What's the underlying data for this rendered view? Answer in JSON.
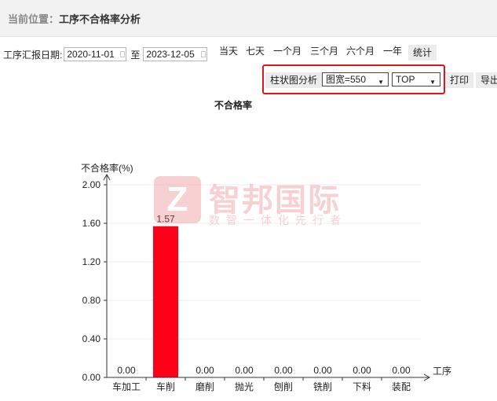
{
  "breadcrumb": {
    "label": "当前位置：",
    "page": "工序不合格率分析"
  },
  "filter": {
    "date_label": "工序汇报日期:",
    "start_date": "2020-11-01",
    "to_label": "至",
    "end_date": "2023-12-05",
    "quick_ranges": [
      "当天",
      "七天",
      "一个月",
      "三个月",
      "六个月",
      "一年"
    ],
    "stat_button": "统计"
  },
  "toolbar": {
    "chart_analysis_button": "柱状图分析",
    "width_select": "图宽=550",
    "top_select": "TOP",
    "print_button": "打印",
    "export_button": "导出"
  },
  "watermark": {
    "logo_letter": "Z",
    "brand": "智邦国际",
    "slogan": "数智一体化先行者"
  },
  "colors": {
    "bar": "#ff0019",
    "highlight_border": "#e3141c",
    "header_bg": "#f2f2f2"
  },
  "chart_data": {
    "type": "bar",
    "title": "不合格率",
    "ylabel": "不合格率(%)",
    "xlabel": "工序",
    "categories": [
      "车加工",
      "车削",
      "磨削",
      "抛光",
      "刨削",
      "铣削",
      "下料",
      "装配"
    ],
    "values": [
      0.0,
      1.57,
      0.0,
      0.0,
      0.0,
      0.0,
      0.0,
      0.0
    ],
    "value_labels": [
      "0.00",
      "1.57",
      "0.00",
      "0.00",
      "0.00",
      "0.00",
      "0.00",
      "0.00"
    ],
    "yticks": [
      "0.00",
      "0.40",
      "0.80",
      "1.20",
      "1.60",
      "2.00"
    ],
    "ylim": [
      0,
      2.0
    ],
    "grid": true
  }
}
